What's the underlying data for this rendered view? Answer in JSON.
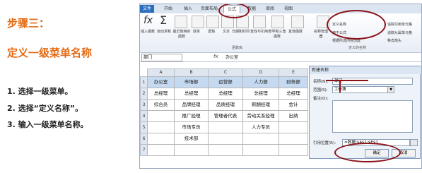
{
  "instructions": {
    "title": "步骤三：",
    "subtitle": "定义一级菜单名称",
    "steps": [
      "1.  选择一级菜单。",
      "2.  选择“定义名称”。",
      "3.  输入一级菜单名称。"
    ]
  },
  "excel": {
    "tabs": [
      "文件",
      "开始",
      "插入",
      "页面布局",
      "公式",
      "数据",
      "审阅",
      "视图"
    ],
    "active_tab": "公式",
    "ribbon": {
      "buttons": [
        "插入函数",
        "自动求和",
        "最近使用的函数",
        "财务",
        "逻辑",
        "文本",
        "日期和时间",
        "查找与引用",
        "数学和三角函数",
        "其他函数",
        "名称管理器"
      ],
      "group_label": "函数库",
      "name_items": [
        "定义名称",
        "用于公式",
        "根据所选内容创建"
      ],
      "name_group": "定义的名称",
      "audit_items": [
        "追踪引用单元格",
        "追踪从属单元格",
        "移去箭头"
      ]
    },
    "name_box": "部门",
    "fx": "fx",
    "formula_value": "办公室",
    "columns": [
      "A",
      "B",
      "C",
      "D",
      "E"
    ],
    "rows": [
      "1",
      "2",
      "3",
      "4",
      "5",
      "6",
      "7"
    ],
    "cells": [
      [
        "办公室",
        "市场部",
        "运营部",
        "人力部",
        "财务部"
      ],
      [
        "总经理",
        "总经理",
        "总经理",
        "总经理",
        "总经理"
      ],
      [
        "综合员",
        "品牌经理",
        "品质经理",
        "薪酬经理",
        "会计"
      ],
      [
        "",
        "推广经理",
        "管理者代表",
        "劳动关系经理",
        "出纳"
      ],
      [
        "",
        "市场专员",
        "",
        "人力专员",
        ""
      ],
      [
        "",
        "技术部",
        "",
        "",
        ""
      ],
      [
        "",
        "",
        "",
        "",
        ""
      ]
    ],
    "dialog": {
      "title": "新建名称",
      "name_label": "名称(N):",
      "name_value": "部门",
      "scope_label": "范围(S):",
      "scope_value": "工作簿",
      "comment_label": "备注(O):",
      "ref_label": "引用位置(R):",
      "ref_value": "=数据!$A$1:$E$1",
      "ok": "确定",
      "cancel": "取消"
    }
  }
}
